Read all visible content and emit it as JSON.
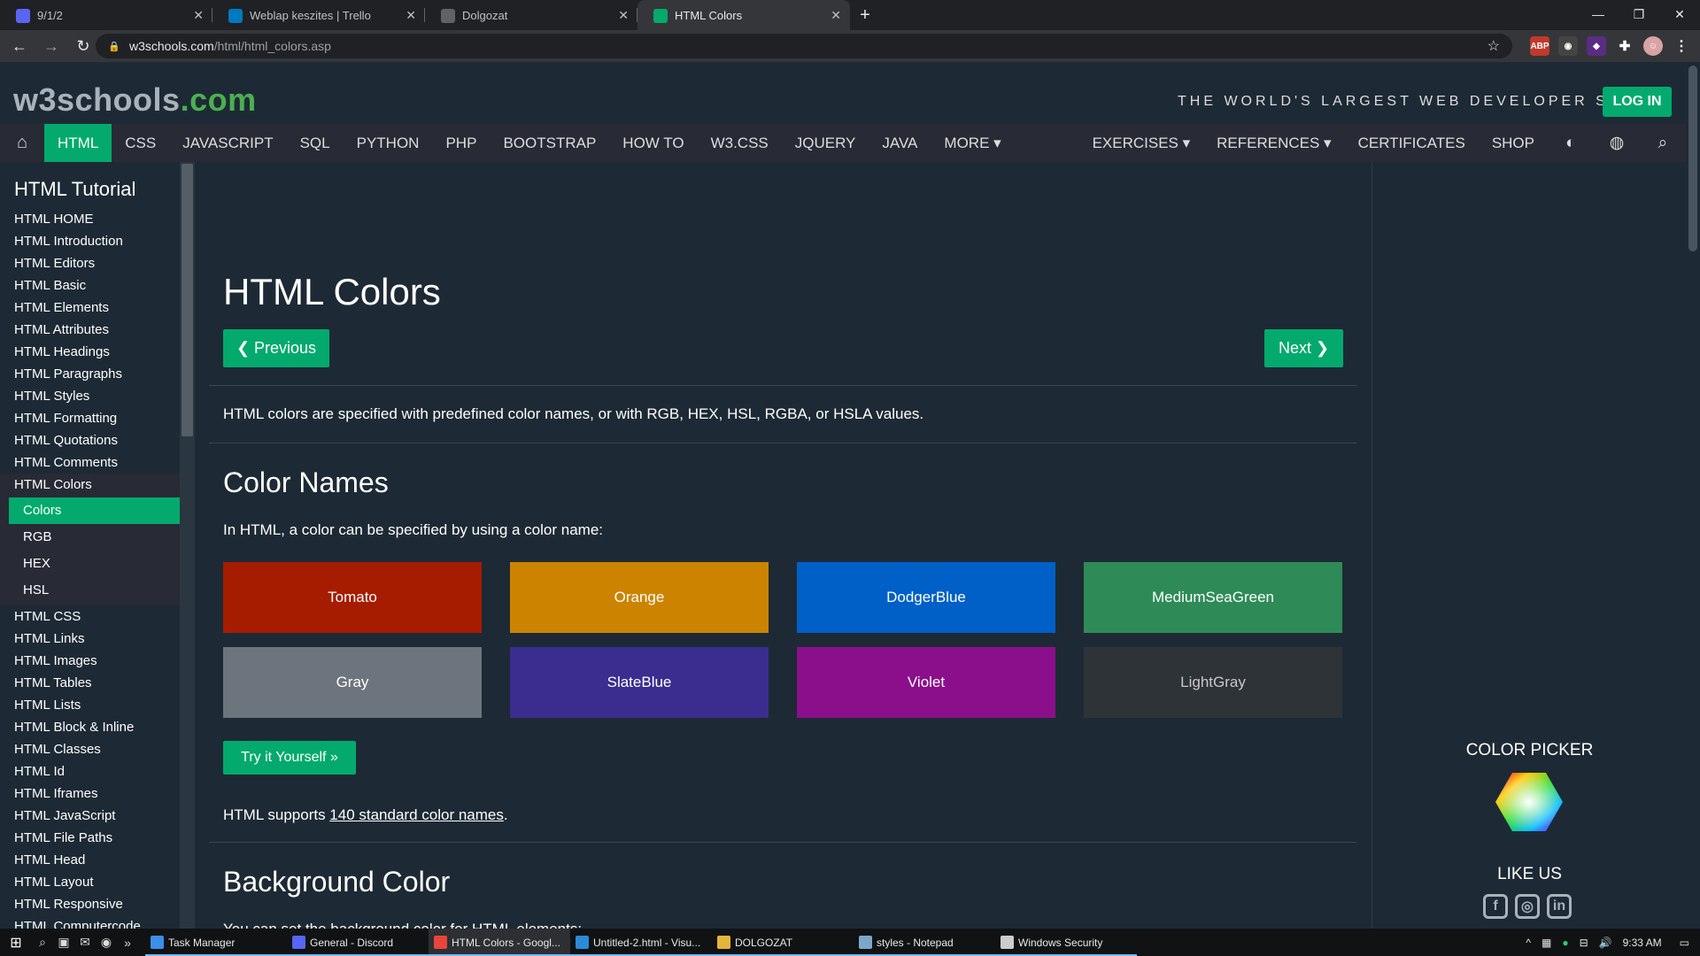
{
  "browser": {
    "tabs": [
      {
        "title": "9/1/2",
        "icon": "discord-icon",
        "color": "#5865f2",
        "active": false
      },
      {
        "title": "Weblap keszites | Trello",
        "icon": "trello-icon",
        "color": "#0079bf",
        "active": false
      },
      {
        "title": "Dolgozat",
        "icon": "globe-icon",
        "color": "#5f6368",
        "active": false
      },
      {
        "title": "HTML Colors",
        "icon": "w3schools-icon",
        "color": "#04aa6d",
        "active": true
      }
    ],
    "url_domain": "w3schools.com",
    "url_path": "/html/html_colors.asp"
  },
  "header": {
    "logo_main": "w3schools",
    "logo_tld": ".com",
    "tagline": "THE WORLD'S LARGEST WEB DEVELOPER SITE",
    "login": "LOG IN"
  },
  "topnav": {
    "items": [
      "HTML",
      "CSS",
      "JAVASCRIPT",
      "SQL",
      "PYTHON",
      "PHP",
      "BOOTSTRAP",
      "HOW TO",
      "W3.CSS",
      "JQUERY",
      "JAVA",
      "MORE ▾"
    ],
    "right_items": [
      "EXERCISES ▾",
      "REFERENCES ▾",
      "CERTIFICATES",
      "SHOP"
    ]
  },
  "sidebar": {
    "title": "HTML Tutorial",
    "items_before": [
      "HTML HOME",
      "HTML Introduction",
      "HTML Editors",
      "HTML Basic",
      "HTML Elements",
      "HTML Attributes",
      "HTML Headings",
      "HTML Paragraphs",
      "HTML Styles",
      "HTML Formatting",
      "HTML Quotations",
      "HTML Comments"
    ],
    "open_item": "HTML Colors",
    "sub_items": [
      "Colors",
      "RGB",
      "HEX",
      "HSL"
    ],
    "items_after": [
      "HTML CSS",
      "HTML Links",
      "HTML Images",
      "HTML Tables",
      "HTML Lists",
      "HTML Block & Inline",
      "HTML Classes",
      "HTML Id",
      "HTML Iframes",
      "HTML JavaScript",
      "HTML File Paths",
      "HTML Head",
      "HTML Layout",
      "HTML Responsive",
      "HTML Computercode"
    ]
  },
  "main": {
    "title": "HTML Colors",
    "prev": "❮ Previous",
    "next": "Next ❯",
    "intro": "HTML colors are specified with predefined color names, or with RGB, HEX, HSL, RGBA, or HSLA values.",
    "color_names_heading": "Color Names",
    "color_names_text": "In HTML, a color can be specified by using a color name:",
    "swatches": [
      {
        "name": "Tomato",
        "color": "#a61c00",
        "text": "#ffffff"
      },
      {
        "name": "Orange",
        "color": "#cc8400",
        "text": "#ffffff"
      },
      {
        "name": "DodgerBlue",
        "color": "#0060c8",
        "text": "#ffffff"
      },
      {
        "name": "MediumSeaGreen",
        "color": "#2e8b57",
        "text": "#ffffff"
      },
      {
        "name": "Gray",
        "color": "#6c757d",
        "text": "#ffffff"
      },
      {
        "name": "SlateBlue",
        "color": "#3a2d8f",
        "text": "#ffffff"
      },
      {
        "name": "Violet",
        "color": "#8b0f8b",
        "text": "#ffffff"
      },
      {
        "name": "LightGray",
        "color": "#2e3338",
        "text": "#c8c8c8"
      }
    ],
    "try_it": "Try it Yourself »",
    "supports_prefix": "HTML supports ",
    "supports_link": "140 standard color names",
    "supports_suffix": ".",
    "bg_heading": "Background Color",
    "bg_text": "You can set the background color for HTML elements:"
  },
  "right": {
    "color_picker": "COLOR PICKER",
    "like_us": "LIKE US"
  },
  "taskbar": {
    "apps": [
      {
        "label": "Task Manager",
        "color": "#3b8eea",
        "active": false
      },
      {
        "label": "General - Discord",
        "color": "#5865f2",
        "active": false
      },
      {
        "label": "HTML Colors - Googl...",
        "color": "#e8453c",
        "active": true
      },
      {
        "label": "Untitled-2.html - Visu...",
        "color": "#2a8ad8",
        "active": false
      },
      {
        "label": "DOLGOZAT",
        "color": "#e5b53b",
        "active": false
      },
      {
        "label": "styles - Notepad",
        "color": "#7da7c9",
        "active": false
      },
      {
        "label": "Windows Security",
        "color": "#cccccc",
        "active": false
      }
    ],
    "time": "9:33 AM"
  }
}
